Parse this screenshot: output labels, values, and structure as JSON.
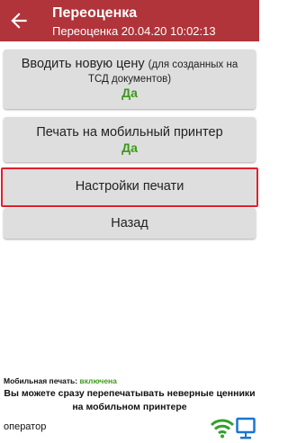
{
  "header": {
    "title": "Переоценка",
    "subtitle": "Переоценка 20.04.20 10:02:13",
    "color": "#b0343a"
  },
  "menu": {
    "new_price": {
      "label": "Вводить новую цену",
      "note_part1": "(для созданных на",
      "note_part2": "ТСД документов)",
      "value": "Да"
    },
    "mobile_printer": {
      "label": "Печать на мобильный принтер",
      "value": "Да"
    },
    "print_settings": {
      "label": "Настройки печати"
    },
    "back": {
      "label": "Назад"
    }
  },
  "status": {
    "mobile_print_label": "Мобильная печать:",
    "mobile_print_value": "включена",
    "notice_line1": "Вы можете сразу перепечатывать неверные ценники",
    "notice_line2": "на мобильном принтере",
    "user": "оператор",
    "icons": [
      "wifi-icon",
      "monitor-icon"
    ],
    "accent_color": "#3c9a1a",
    "highlight_color": "#e0202e"
  }
}
